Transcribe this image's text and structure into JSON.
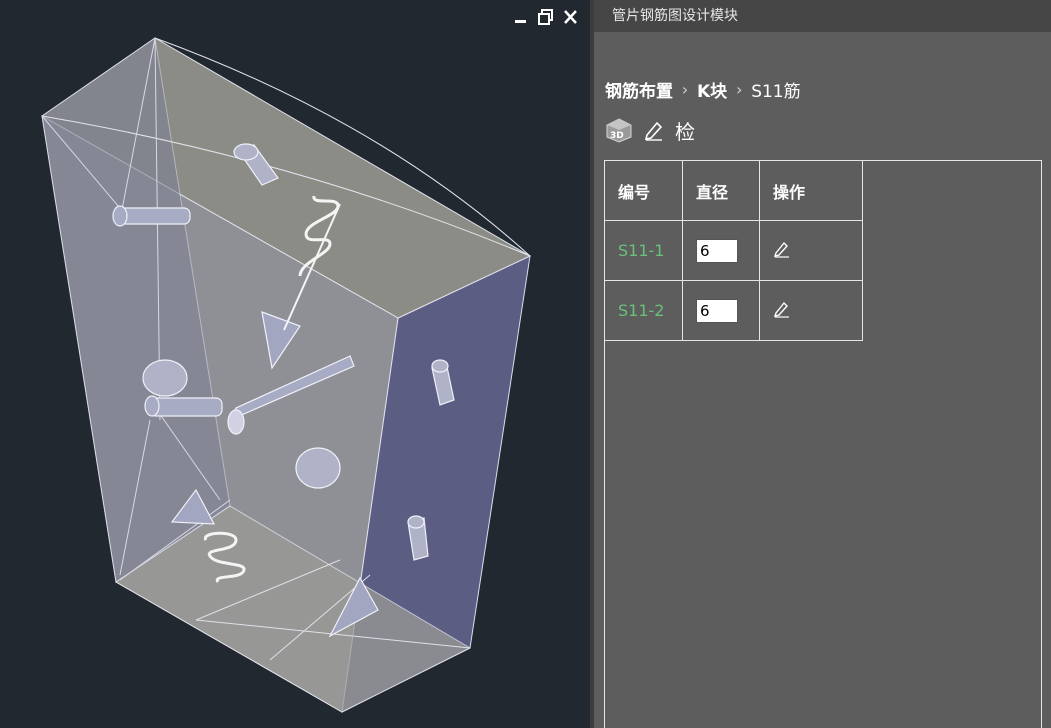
{
  "panel": {
    "title": "管片钢筋图设计模块"
  },
  "breadcrumb": [
    {
      "label": "钢筋布置"
    },
    {
      "label": "K块"
    },
    {
      "label": "S11筋"
    }
  ],
  "toolbar": {
    "view3d_icon": "3d-icon",
    "edit_icon": "pencil-icon",
    "check_label": "检"
  },
  "table": {
    "headers": [
      "编号",
      "直径",
      "操作"
    ],
    "rows": [
      {
        "code": "S11-1",
        "diameter": "6",
        "action_icon": "pencil-icon"
      },
      {
        "code": "S11-2",
        "diameter": "6",
        "action_icon": "pencil-icon"
      }
    ]
  },
  "window_controls": [
    "minimize-icon",
    "restore-icon",
    "close-icon"
  ],
  "colors": {
    "viewport_bg": "#212830",
    "panel_bg": "#5d5d5d",
    "title_bg": "#464646",
    "code_text": "#6ac07a"
  }
}
